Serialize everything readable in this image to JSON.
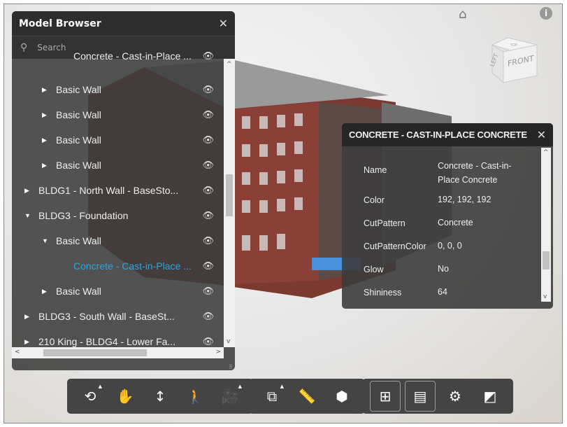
{
  "model_browser": {
    "title": "Model Browser",
    "search_placeholder": "Search",
    "items": [
      {
        "label": "Concrete - Cast-in-Place ...",
        "indent": 3,
        "expander": "none"
      },
      {
        "label": "Basic Wall",
        "indent": 2,
        "expander": "collapsed"
      },
      {
        "label": "Basic Wall",
        "indent": 2,
        "expander": "collapsed"
      },
      {
        "label": "Basic Wall",
        "indent": 2,
        "expander": "collapsed"
      },
      {
        "label": "Basic Wall",
        "indent": 2,
        "expander": "collapsed"
      },
      {
        "label": "BLDG1 - North Wall - BaseSto...",
        "indent": 1,
        "expander": "collapsed"
      },
      {
        "label": "BLDG3 - Foundation",
        "indent": 1,
        "expander": "expanded"
      },
      {
        "label": "Basic Wall",
        "indent": 2,
        "expander": "expanded"
      },
      {
        "label": "Concrete - Cast-in-Place ...",
        "indent": 3,
        "expander": "none",
        "selected": true
      },
      {
        "label": "Basic Wall",
        "indent": 2,
        "expander": "collapsed"
      },
      {
        "label": "BLDG3 - South Wall - BaseSt...",
        "indent": 1,
        "expander": "collapsed"
      },
      {
        "label": "210 King - BLDG4 - Lower Fa...",
        "indent": 1,
        "expander": "collapsed"
      }
    ]
  },
  "properties": {
    "title": "CONCRETE - CAST-IN-PLACE CONCRETE",
    "rows": [
      {
        "name": "Name",
        "value": "Concrete - Cast-in-Place Concrete"
      },
      {
        "name": "Color",
        "value": "192, 192, 192"
      },
      {
        "name": "CutPattern",
        "value": "Concrete"
      },
      {
        "name": "CutPatternColor",
        "value": " 0, 0, 0"
      },
      {
        "name": "Glow",
        "value": "No"
      },
      {
        "name": "Shininess",
        "value": "64"
      }
    ]
  },
  "viewcube": {
    "left": "LEFT",
    "front": "FRONT",
    "top": "TOP"
  },
  "toolbar": {
    "groups": [
      [
        {
          "icon": "orbit-icon",
          "sub": true
        },
        {
          "icon": "pan-icon"
        },
        {
          "icon": "zoom-icon"
        },
        {
          "icon": "first-person-icon"
        },
        {
          "icon": "camera-icon",
          "sub": true
        }
      ],
      [
        {
          "icon": "section-icon",
          "sub": true
        },
        {
          "icon": "measure-icon"
        },
        {
          "icon": "explode-icon"
        }
      ],
      [
        {
          "icon": "model-browser-icon",
          "active": true
        },
        {
          "icon": "properties-icon",
          "active": true
        },
        {
          "icon": "settings-icon"
        },
        {
          "icon": "fullscreen-icon"
        }
      ]
    ]
  },
  "colors": {
    "selected": "#2aa6e0",
    "panel": "#3c3c3c"
  }
}
